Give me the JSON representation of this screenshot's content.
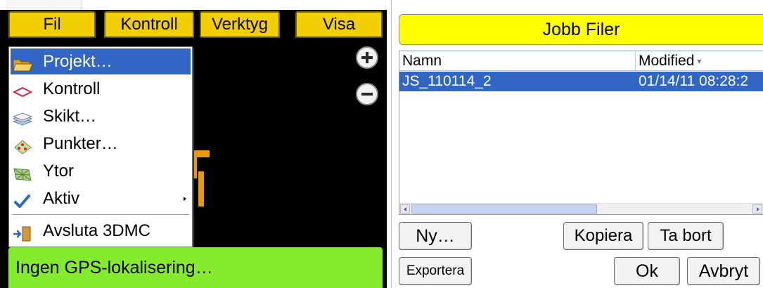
{
  "menubar": {
    "items": [
      {
        "label": "Fil"
      },
      {
        "label": "Kontroll"
      },
      {
        "label": "Verktyg"
      },
      {
        "label": "Visa"
      }
    ]
  },
  "file_menu": {
    "items": [
      {
        "label": "Projekt…",
        "icon": "folder-open-icon",
        "selected": true
      },
      {
        "label": "Kontroll",
        "icon": "control-diamond-icon"
      },
      {
        "label": "Skikt…",
        "icon": "layers-icon"
      },
      {
        "label": "Punkter…",
        "icon": "points-icon"
      },
      {
        "label": "Ytor",
        "icon": "surfaces-icon"
      },
      {
        "label": "Aktiv",
        "icon": "checkmark-icon",
        "has_submenu": true
      },
      {
        "label": "Avsluta 3DMC",
        "icon": "exit-door-icon"
      }
    ]
  },
  "status": {
    "gps": "Ingen GPS-lokalisering…"
  },
  "dialog": {
    "title": "Jobb Filer",
    "columns": {
      "name": "Namn",
      "modified": "Modified"
    },
    "rows": [
      {
        "name": "JS_110114_2",
        "modified": "01/14/11 08:28:2"
      }
    ],
    "buttons": {
      "new": "Ny…",
      "copy": "Kopiera",
      "delete": "Ta bort",
      "export": "Exportera",
      "ok": "Ok",
      "cancel": "Avbryt"
    }
  },
  "colors": {
    "menu_tab_yellow": "#f2ce04",
    "selection_blue": "#3166c4",
    "gps_green": "#84ec2c",
    "title_yellow": "#ffff00",
    "map_black": "#000000"
  }
}
